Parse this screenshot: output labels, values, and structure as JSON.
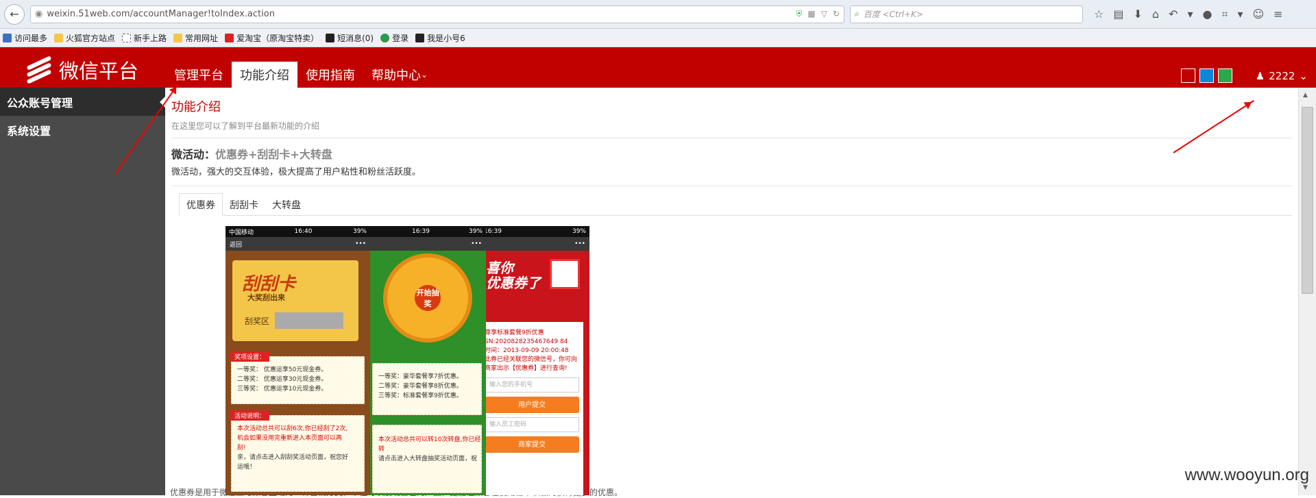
{
  "browser": {
    "url": "weixin.51web.com/accountManager!toIndex.action",
    "search_placeholder": "百度 <Ctrl+K>",
    "bookmarks": [
      "访问最多",
      "火狐官方站点",
      "新手上路",
      "常用网址",
      "爱淘宝（原淘宝特卖）",
      "短消息(0)",
      "登录",
      "我是小号6"
    ]
  },
  "header": {
    "logo_text": "微信平台",
    "nav": [
      "管理平台",
      "功能介绍",
      "使用指南",
      "帮助中心"
    ],
    "active_nav": "功能介绍",
    "theme_colors": [
      "#c10000",
      "#0b86d8",
      "#2aa84a"
    ],
    "user": "2222"
  },
  "sidebar": {
    "items": [
      "公众账号管理",
      "系统设置"
    ]
  },
  "content": {
    "title": "功能介绍",
    "subtitle": "在这里您可以了解到平台最新功能的介绍",
    "section_label": "微活动：",
    "section_features": "优惠券+刮刮卡+大转盘",
    "section_desc": "微活动，强大的交互体验，极大提高了用户粘性和粉丝活跃度。",
    "tabs": [
      "优惠券",
      "刮刮卡",
      "大转盘"
    ],
    "active_tab": "优惠券",
    "bottom_text": "优惠券是用于微信上与顾客互动的一种营销方式，不但可以展现自己的产品，更能让顾客在使用当中积极的获得更多的优惠。"
  },
  "phones": {
    "p1": {
      "carrier": "中国移动",
      "time": "16:40",
      "battery": "39%",
      "back": "返回",
      "menu": "•••",
      "card_title": "刮刮卡",
      "card_sub": "大奖刮出来",
      "area_label": "刮奖区",
      "prize_tag": "奖项设置：",
      "prizes": [
        "一等奖：   优惠运享50元现金券。",
        "二等奖：   优惠运享30元现金券。",
        "三等奖：   优惠运享10元现金券。"
      ],
      "rules_tag": "活动说明：",
      "rules": [
        "本次活动总共可以刮6次,你已经刮了2次,",
        "机会如果没用完重新进入本页面可以再",
        "刮!",
        "亲，请点击进入刮刮奖活动页面，祝您好",
        "运哦！"
      ]
    },
    "p2": {
      "time": "16:39",
      "battery": "39%",
      "menu": "•••",
      "wheel_center": "开始抽奖",
      "prizes": [
        "一等奖：豪华套餐享7折优惠。",
        "二等奖：豪华套餐享8折优惠。",
        "三等奖：标准套餐享9折优惠。"
      ],
      "rules": [
        "本次活动总共可以转10次转盘,你已经转",
        "请点击进入大转盘抽奖活动页面，祝"
      ]
    },
    "p3": {
      "time": "16:39",
      "battery": "39%",
      "menu": "•••",
      "headline_1": "喜你",
      "headline_2": "优惠券了",
      "info": [
        "尊享标准套餐9折优惠",
        "SN:2020828235467649 84",
        "时间：2013-09-09 20:00:48",
        "此券已经关联您的微信号，你可向",
        "商家出示【优惠券】进行查询!"
      ],
      "phone_placeholder": "输入您的手机号",
      "submit": "用户提交",
      "pwd_placeholder": "输入员工密码",
      "merchant_submit": "商家提交"
    }
  },
  "watermark": "www.wooyun.org"
}
